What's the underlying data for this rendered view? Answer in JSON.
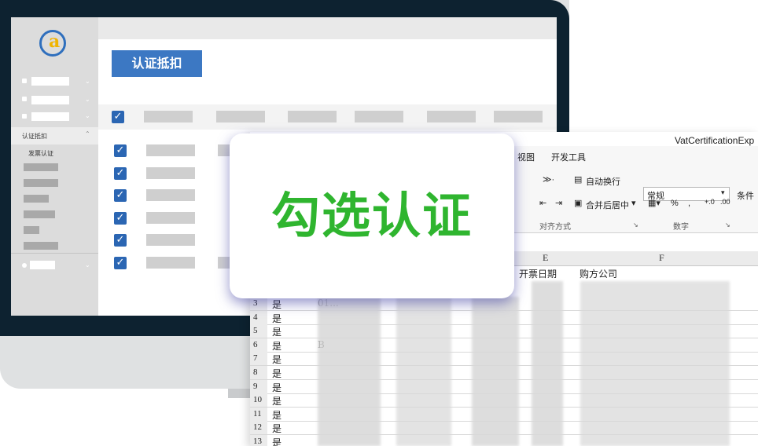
{
  "app": {
    "page_title": "认证抵扣",
    "sidebar": {
      "active_item": "认证抵扣",
      "active_sub_item": "发票认证"
    }
  },
  "excel": {
    "window_title": "VatCertificationExp",
    "tabs": [
      "视图",
      "开发工具"
    ],
    "ribbon": {
      "wrap_text": "自动换行",
      "merge_center": "合并后居中",
      "number_format": "常规",
      "percent": "%",
      "comma": ",",
      "alignment_group": "对齐方式",
      "number_group": "数字",
      "conditional": "条件"
    },
    "columns": [
      "E",
      "F"
    ],
    "headers": [
      "开票日期",
      "购方公司"
    ],
    "rows": [
      {
        "num": "3",
        "a": "是",
        "b": "01..."
      },
      {
        "num": "4",
        "a": "是",
        "b": ""
      },
      {
        "num": "5",
        "a": "是",
        "b": ""
      },
      {
        "num": "6",
        "a": "是",
        "b": "B"
      },
      {
        "num": "7",
        "a": "是",
        "b": ""
      },
      {
        "num": "8",
        "a": "是",
        "b": ""
      },
      {
        "num": "9",
        "a": "是",
        "b": ""
      },
      {
        "num": "10",
        "a": "是",
        "b": ""
      },
      {
        "num": "11",
        "a": "是",
        "b": ""
      },
      {
        "num": "12",
        "a": "是",
        "b": ""
      },
      {
        "num": "13",
        "a": "是",
        "b": ""
      }
    ]
  },
  "callout": {
    "text": "勾选认证",
    "color": "#2fb52f"
  },
  "colors": {
    "primary": "#3c78c3",
    "checkbox": "#2b66b3",
    "bezel": "#0d2230"
  }
}
